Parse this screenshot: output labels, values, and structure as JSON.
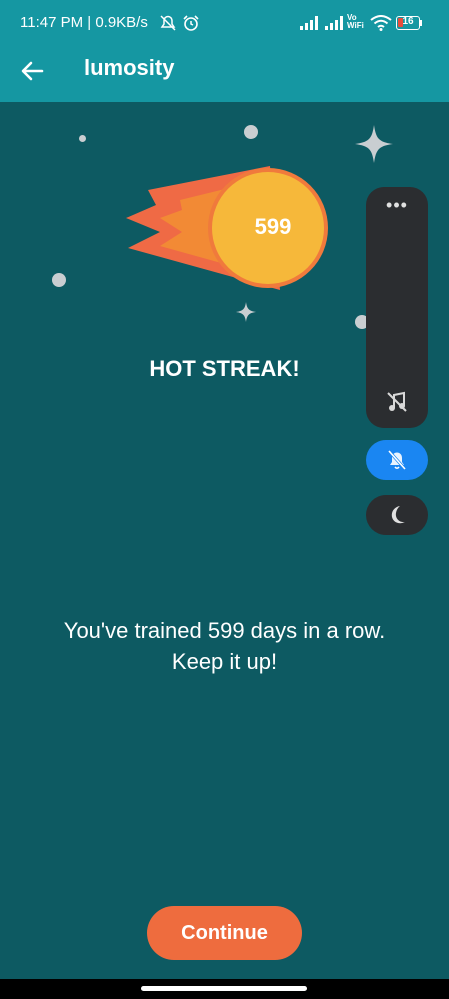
{
  "status_bar": {
    "time_speed": "11:47 PM | 0.9KB/s",
    "vowifi_top": "Vo",
    "vowifi_bottom": "WiFi",
    "battery": "16"
  },
  "header": {
    "title": "lumosity",
    "back_icon": "arrow-left-icon"
  },
  "streak": {
    "count": "599",
    "headline": "HOT STREAK!",
    "message": "You've trained 599 days in a row. Keep it up!"
  },
  "side_panel": {
    "more_label": "•••",
    "icons": [
      "music-off-icon",
      "bell-off-icon",
      "moon-icon"
    ]
  },
  "footer": {
    "continue_label": "Continue"
  },
  "colors": {
    "header": "#1597a2",
    "background": "#0d5a62",
    "accent": "#ee6c3e",
    "comet_core": "#f6b83a",
    "toggle_active": "#1a86f2"
  }
}
